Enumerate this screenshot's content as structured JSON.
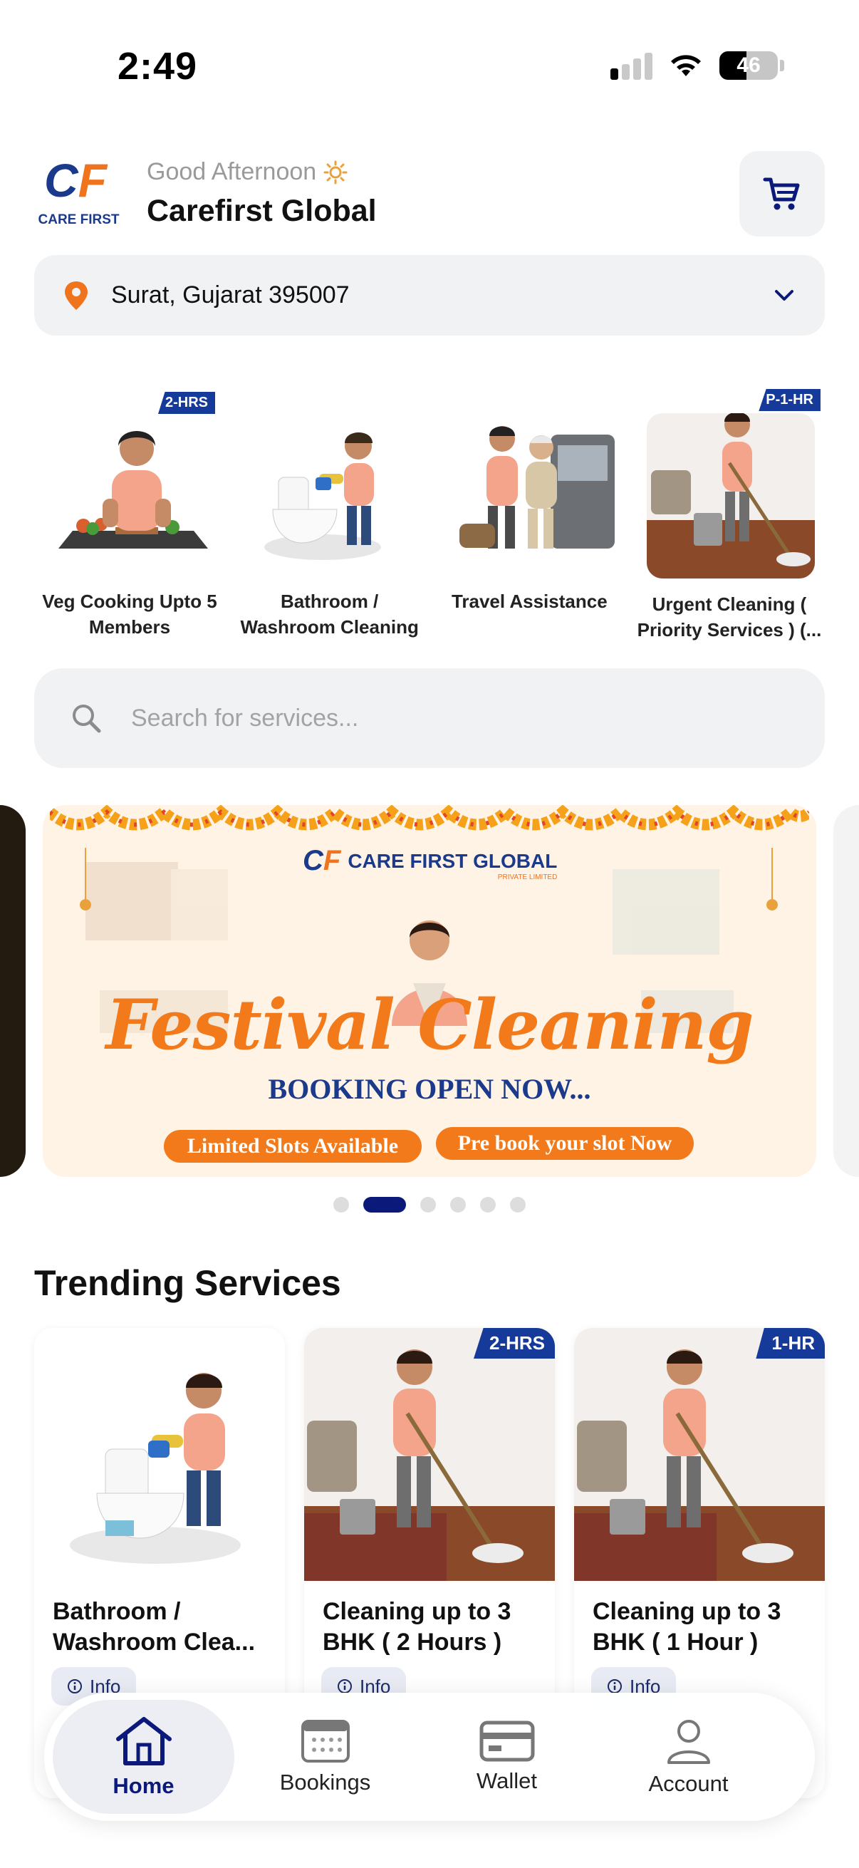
{
  "status_bar": {
    "time": "2:49",
    "battery": "46"
  },
  "header": {
    "logo_mark": "CF",
    "logo_text": "CARE FIRST",
    "greeting": "Good Afternoon",
    "user_name": "Carefirst Global"
  },
  "location": {
    "text": "Surat, Gujarat 395007"
  },
  "categories": [
    {
      "label": "Veg Cooking Upto 5 Members",
      "tag": "2-HRS"
    },
    {
      "label": "Bathroom / Washroom Cleaning",
      "tag": ""
    },
    {
      "label": "Travel Assistance",
      "tag": ""
    },
    {
      "label": "Urgent Cleaning ( Priority Services ) (...",
      "tag": "P-1-HR"
    }
  ],
  "search": {
    "placeholder": "Search for services..."
  },
  "banner": {
    "logo_text": "CARE FIRST GLOBAL",
    "logo_sub": "PRIVATE LIMITED",
    "headline": "Festival Cleaning",
    "subheadline": "BOOKING OPEN NOW...",
    "pill_left": "Limited Slots Available",
    "pill_right": "Pre book your slot Now"
  },
  "carousel": {
    "count": 6,
    "active_index": 1
  },
  "trending": {
    "title": "Trending Services",
    "items": [
      {
        "name": "Bathroom / Washroom Clea...",
        "tag": "",
        "info": "Info"
      },
      {
        "name": "Cleaning up to 3 BHK ( 2 Hours )",
        "tag": "2-HRS",
        "info": "Info"
      },
      {
        "name": "Cleaning up to 3 BHK ( 1 Hour )",
        "tag": "1-HR",
        "info": "Info"
      }
    ]
  },
  "nav": {
    "home": "Home",
    "bookings": "Bookings",
    "wallet": "Wallet",
    "account": "Account"
  },
  "colors": {
    "brand_orange": "#f0731e",
    "brand_navy": "#0b1a7a",
    "surface": "#f1f2f4"
  }
}
